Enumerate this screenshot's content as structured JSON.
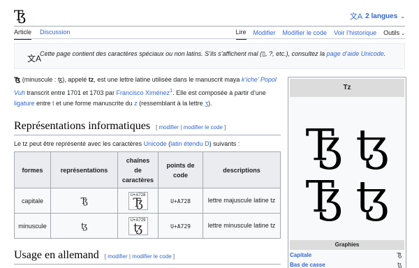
{
  "header": {
    "title": "Ꜩ",
    "lang_icon": "文A",
    "lang_label": "2 langues",
    "chevron": "⌄"
  },
  "tabs": {
    "left": [
      "Article",
      "Discussion"
    ],
    "right": [
      "Lire",
      "Modifier",
      "Modifier le code",
      "Voir l’historique"
    ],
    "tools": "Outils"
  },
  "notice": {
    "icon": "文A",
    "text": "Cette page contient des caractères spéciaux ou non latins. S’ils s’affichent mal (▯, ?, etc.), consultez la ",
    "link": "page d’aide Unicode",
    "end": "."
  },
  "intro": {
    "s1": "Ꜩ",
    "s2": " (minuscule : ",
    "s3": "ꜩ",
    "s4": "), appelé ",
    "s5": "tz",
    "s6": ", est une lettre latine utilisée dans le manuscrit maya ",
    "l1": "k’iche’ Popol Vuh",
    "s7": " transcrit entre 1701 et 1703 par ",
    "l2": "Francisco Ximénez",
    "sup": "1",
    "s8": ". Elle est composée à partir d’une ",
    "l3": "ligature",
    "s9": " entre ",
    "l4": "t",
    "s10": " et une forme manuscrite du ",
    "l5": "z",
    "s11": " (ressemblant à la lettre ",
    "l6": "ʒ",
    "s12": ")."
  },
  "section1": {
    "heading": "Représentations informatiques",
    "edit_open": "[ ",
    "edit1": "modifier",
    "edit_sep": " | ",
    "edit2": "modifier le code",
    "edit_close": " ]"
  },
  "section1_para": {
    "s1": "Le tz peut être représenté avec les caractères ",
    "l1": "Unicode",
    "s2": " (",
    "l2": "latin étendu D",
    "s3": ") suivants :"
  },
  "table": {
    "headers": [
      "formes",
      "représentations",
      "chaînes de caractères",
      "points de code",
      "descriptions"
    ],
    "rows": [
      {
        "form": "capitale",
        "repr": "Ꜩ",
        "cp_small": "U+A728",
        "glyph": "Ꜩ",
        "code": "U+A728",
        "desc": "lettre majuscule latine tz"
      },
      {
        "form": "minuscule",
        "repr": "ꜩ",
        "cp_small": "U+A729",
        "glyph": "ꜩ",
        "code": "U+A729",
        "desc": "lettre minuscule latine tz"
      }
    ]
  },
  "section2": {
    "heading": "Usage en allemand",
    "edit_open": "[ ",
    "edit1": "modifier",
    "edit_sep": " | ",
    "edit2": "modifier le code",
    "edit_close": " ]"
  },
  "infobox": {
    "title": "Tz",
    "glyph_row1": "Ꜩ ꜩ",
    "glyph_row2": "Ꜩ ꜩ",
    "subheader": "Graphies",
    "rows": [
      {
        "label": "Capitale",
        "value": "Ꜩ"
      },
      {
        "label": "Bas de casse",
        "value": "ꜩ"
      }
    ]
  }
}
